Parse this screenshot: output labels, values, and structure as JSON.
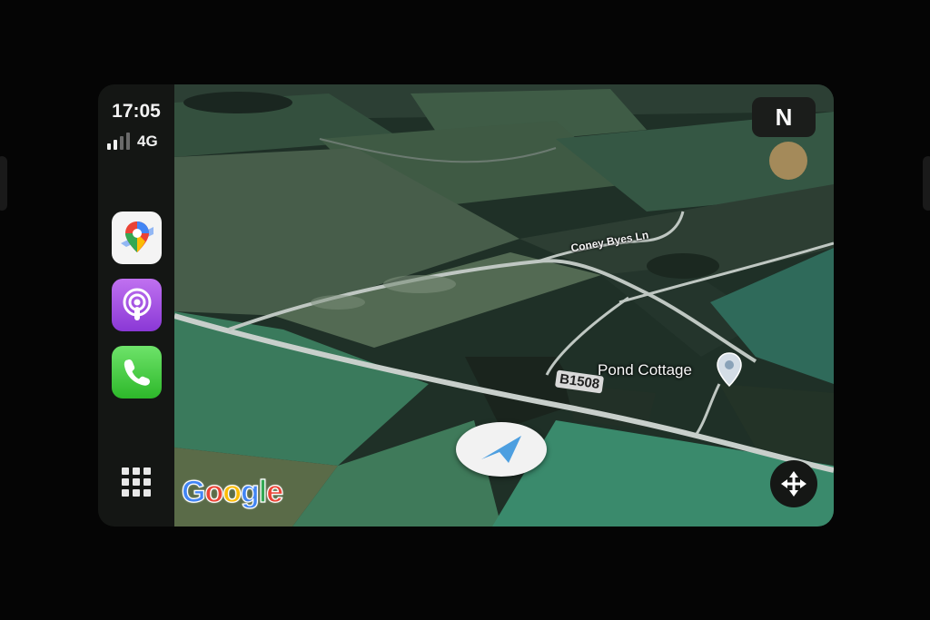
{
  "status": {
    "time": "17:05",
    "network": "4G",
    "signal_bars": 4,
    "signal_active": 2
  },
  "dock": {
    "apps": [
      {
        "name": "Google Maps",
        "icon": "google-maps-icon"
      },
      {
        "name": "Podcasts",
        "icon": "podcasts-icon"
      },
      {
        "name": "Phone",
        "icon": "phone-icon"
      }
    ],
    "launcher_icon": "app-grid-icon"
  },
  "map": {
    "compass_label": "N",
    "roads": {
      "coney": "Coney Byes Ln",
      "main": "B1508"
    },
    "place": {
      "label": "Pond Cottage",
      "icon": "location-pin-icon"
    },
    "attribution": {
      "letters": [
        "G",
        "o",
        "o",
        "g",
        "l",
        "e"
      ],
      "colors": [
        "#4285F4",
        "#EA4335",
        "#FBBC05",
        "#4285F4",
        "#34A853",
        "#EA4335"
      ]
    },
    "recenter_icon": "move-arrows-icon",
    "puck_icon": "navigation-arrow-icon"
  }
}
